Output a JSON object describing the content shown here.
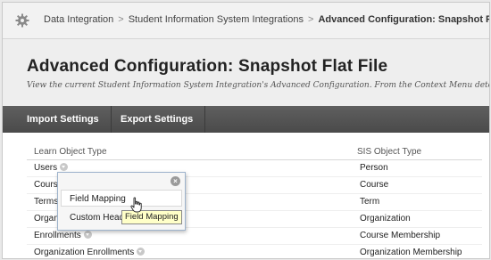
{
  "breadcrumb": {
    "items": [
      "Data Integration",
      "Student Information System Integrations",
      "Advanced Configuration: Snapshot Flat File"
    ],
    "separator": ">"
  },
  "page": {
    "title": "Advanced Configuration: Snapshot Flat File",
    "description": "View the current Student Information System Integration's Advanced Configuration. From the Context Menu determ"
  },
  "toolbar": {
    "import_label": "Import Settings",
    "export_label": "Export Settings"
  },
  "table": {
    "headers": [
      "Learn Object Type",
      "SIS Object Type"
    ],
    "rows": [
      {
        "learn": "Users",
        "sis": "Person"
      },
      {
        "learn": "Cours",
        "sis": "Course"
      },
      {
        "learn": "Terms",
        "sis": "Term"
      },
      {
        "learn": "Organ",
        "sis": "Organization"
      },
      {
        "learn": "Enrollments",
        "sis": "Course Membership"
      },
      {
        "learn": "Organization Enrollments",
        "sis": "Organization Membership"
      }
    ]
  },
  "context_menu": {
    "items": [
      "Field Mapping",
      "Custom Head"
    ],
    "tooltip": "Field Mapping"
  },
  "colors": {
    "toolbar": "#4f4f4f",
    "popup_border": "#9db3cc",
    "tooltip_bg": "#ffffc8"
  },
  "icons": [
    "gear-icon",
    "context-menu-icon",
    "close-icon",
    "hand-cursor-icon"
  ]
}
